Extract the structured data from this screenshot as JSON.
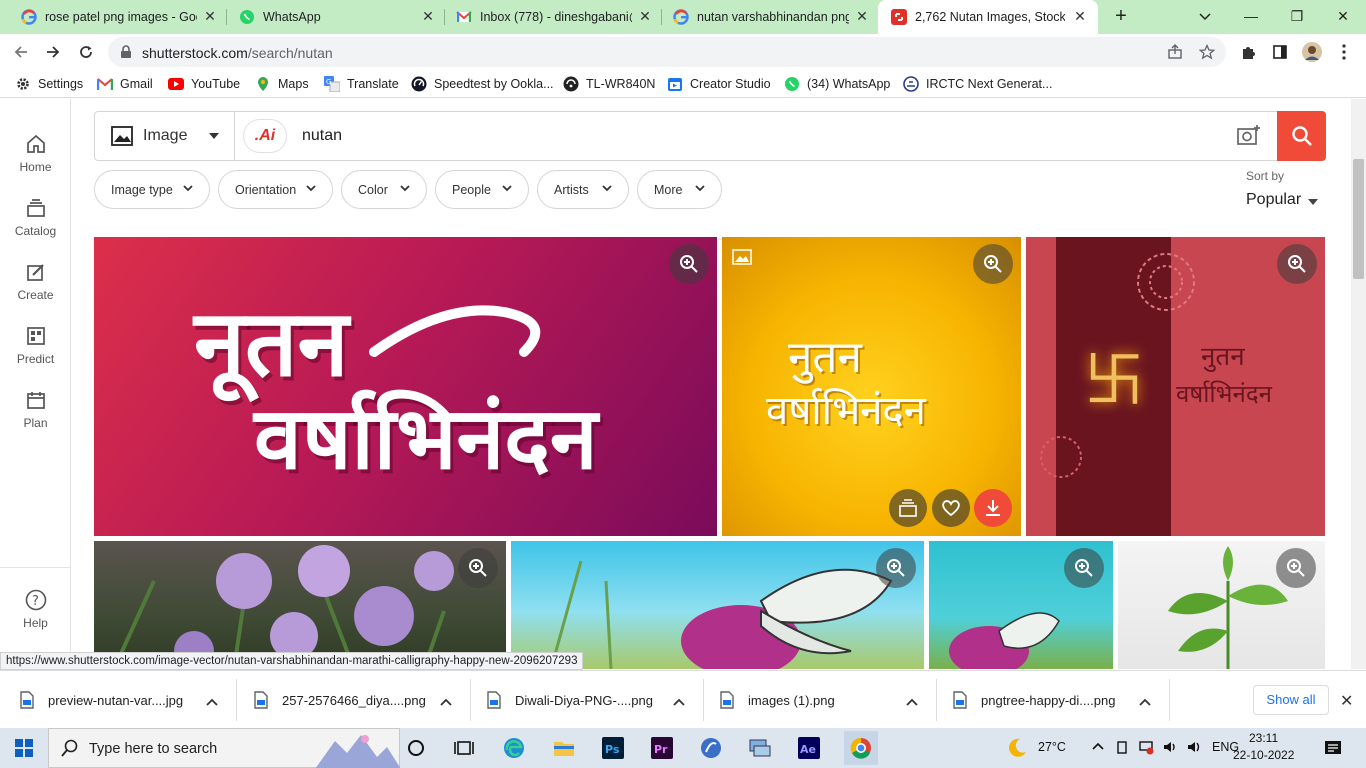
{
  "tabs": [
    {
      "title": "rose patel png images - Goo",
      "icon": "google-icon",
      "active": false
    },
    {
      "title": "WhatsApp",
      "icon": "whatsapp-icon",
      "active": false
    },
    {
      "title": "Inbox (778) - dineshgabani@",
      "icon": "gmail-icon",
      "active": false
    },
    {
      "title": "nutan varshabhinandan png",
      "icon": "google-icon",
      "active": false
    },
    {
      "title": "2,762 Nutan Images, Stock Ph",
      "icon": "shutterstock-icon",
      "active": true
    }
  ],
  "address": {
    "domain": "shutterstock.com",
    "path": "/search/nutan"
  },
  "bookmarks": [
    {
      "label": "Settings",
      "icon": "gear-icon"
    },
    {
      "label": "Gmail",
      "icon": "gmail-icon"
    },
    {
      "label": "YouTube",
      "icon": "youtube-icon"
    },
    {
      "label": "Maps",
      "icon": "maps-icon"
    },
    {
      "label": "Translate",
      "icon": "translate-icon"
    },
    {
      "label": "Speedtest by Ookla...",
      "icon": "speedtest-icon"
    },
    {
      "label": "TL-WR840N",
      "icon": "router-icon"
    },
    {
      "label": "Creator Studio",
      "icon": "creator-studio-icon"
    },
    {
      "label": "(34) WhatsApp",
      "icon": "whatsapp-icon"
    },
    {
      "label": "IRCTC Next Generat...",
      "icon": "irctc-icon"
    }
  ],
  "rail": [
    {
      "label": "Home",
      "icon": "home-icon"
    },
    {
      "label": "Catalog",
      "icon": "catalog-icon"
    },
    {
      "label": "Create",
      "icon": "create-icon"
    },
    {
      "label": "Predict",
      "icon": "predict-icon"
    },
    {
      "label": "Plan",
      "icon": "plan-icon"
    },
    {
      "label": "Help",
      "icon": "help-icon"
    }
  ],
  "search": {
    "type_label": "Image",
    "ai_chip": ".Ai",
    "query": "nutan"
  },
  "filters": [
    "Image type",
    "Orientation",
    "Color",
    "People",
    "Artists",
    "More"
  ],
  "sort": {
    "label": "Sort by",
    "value": "Popular"
  },
  "tiles": {
    "t1": {
      "line1": "नूतन",
      "line2": "वर्षाभिनंदन"
    },
    "t2": {
      "line1": "नुतन",
      "line2": "वर्षाभिनंदन"
    },
    "t3": {
      "line1": "नुतन",
      "line2": "वर्षाभिनंदन",
      "symbol": "卐"
    }
  },
  "status_url": "https://www.shutterstock.com/image-vector/nutan-varshabhinandan-marathi-calligraphy-happy-new-2096207293",
  "downloads": [
    {
      "name": "preview-nutan-var....jpg"
    },
    {
      "name": "257-2576466_diya....png"
    },
    {
      "name": "Diwali-Diya-PNG-....png"
    },
    {
      "name": "images (1).png"
    },
    {
      "name": "pngtree-happy-di....png"
    }
  ],
  "shelf": {
    "show_all": "Show all"
  },
  "taskbar": {
    "search_placeholder": "Type here to search",
    "weather": "27°C",
    "lang": "ENG",
    "time": "23:11",
    "date": "22-10-2022"
  },
  "colors": {
    "accent": "#f04a38",
    "tabstrip": "#c4ecc4"
  }
}
